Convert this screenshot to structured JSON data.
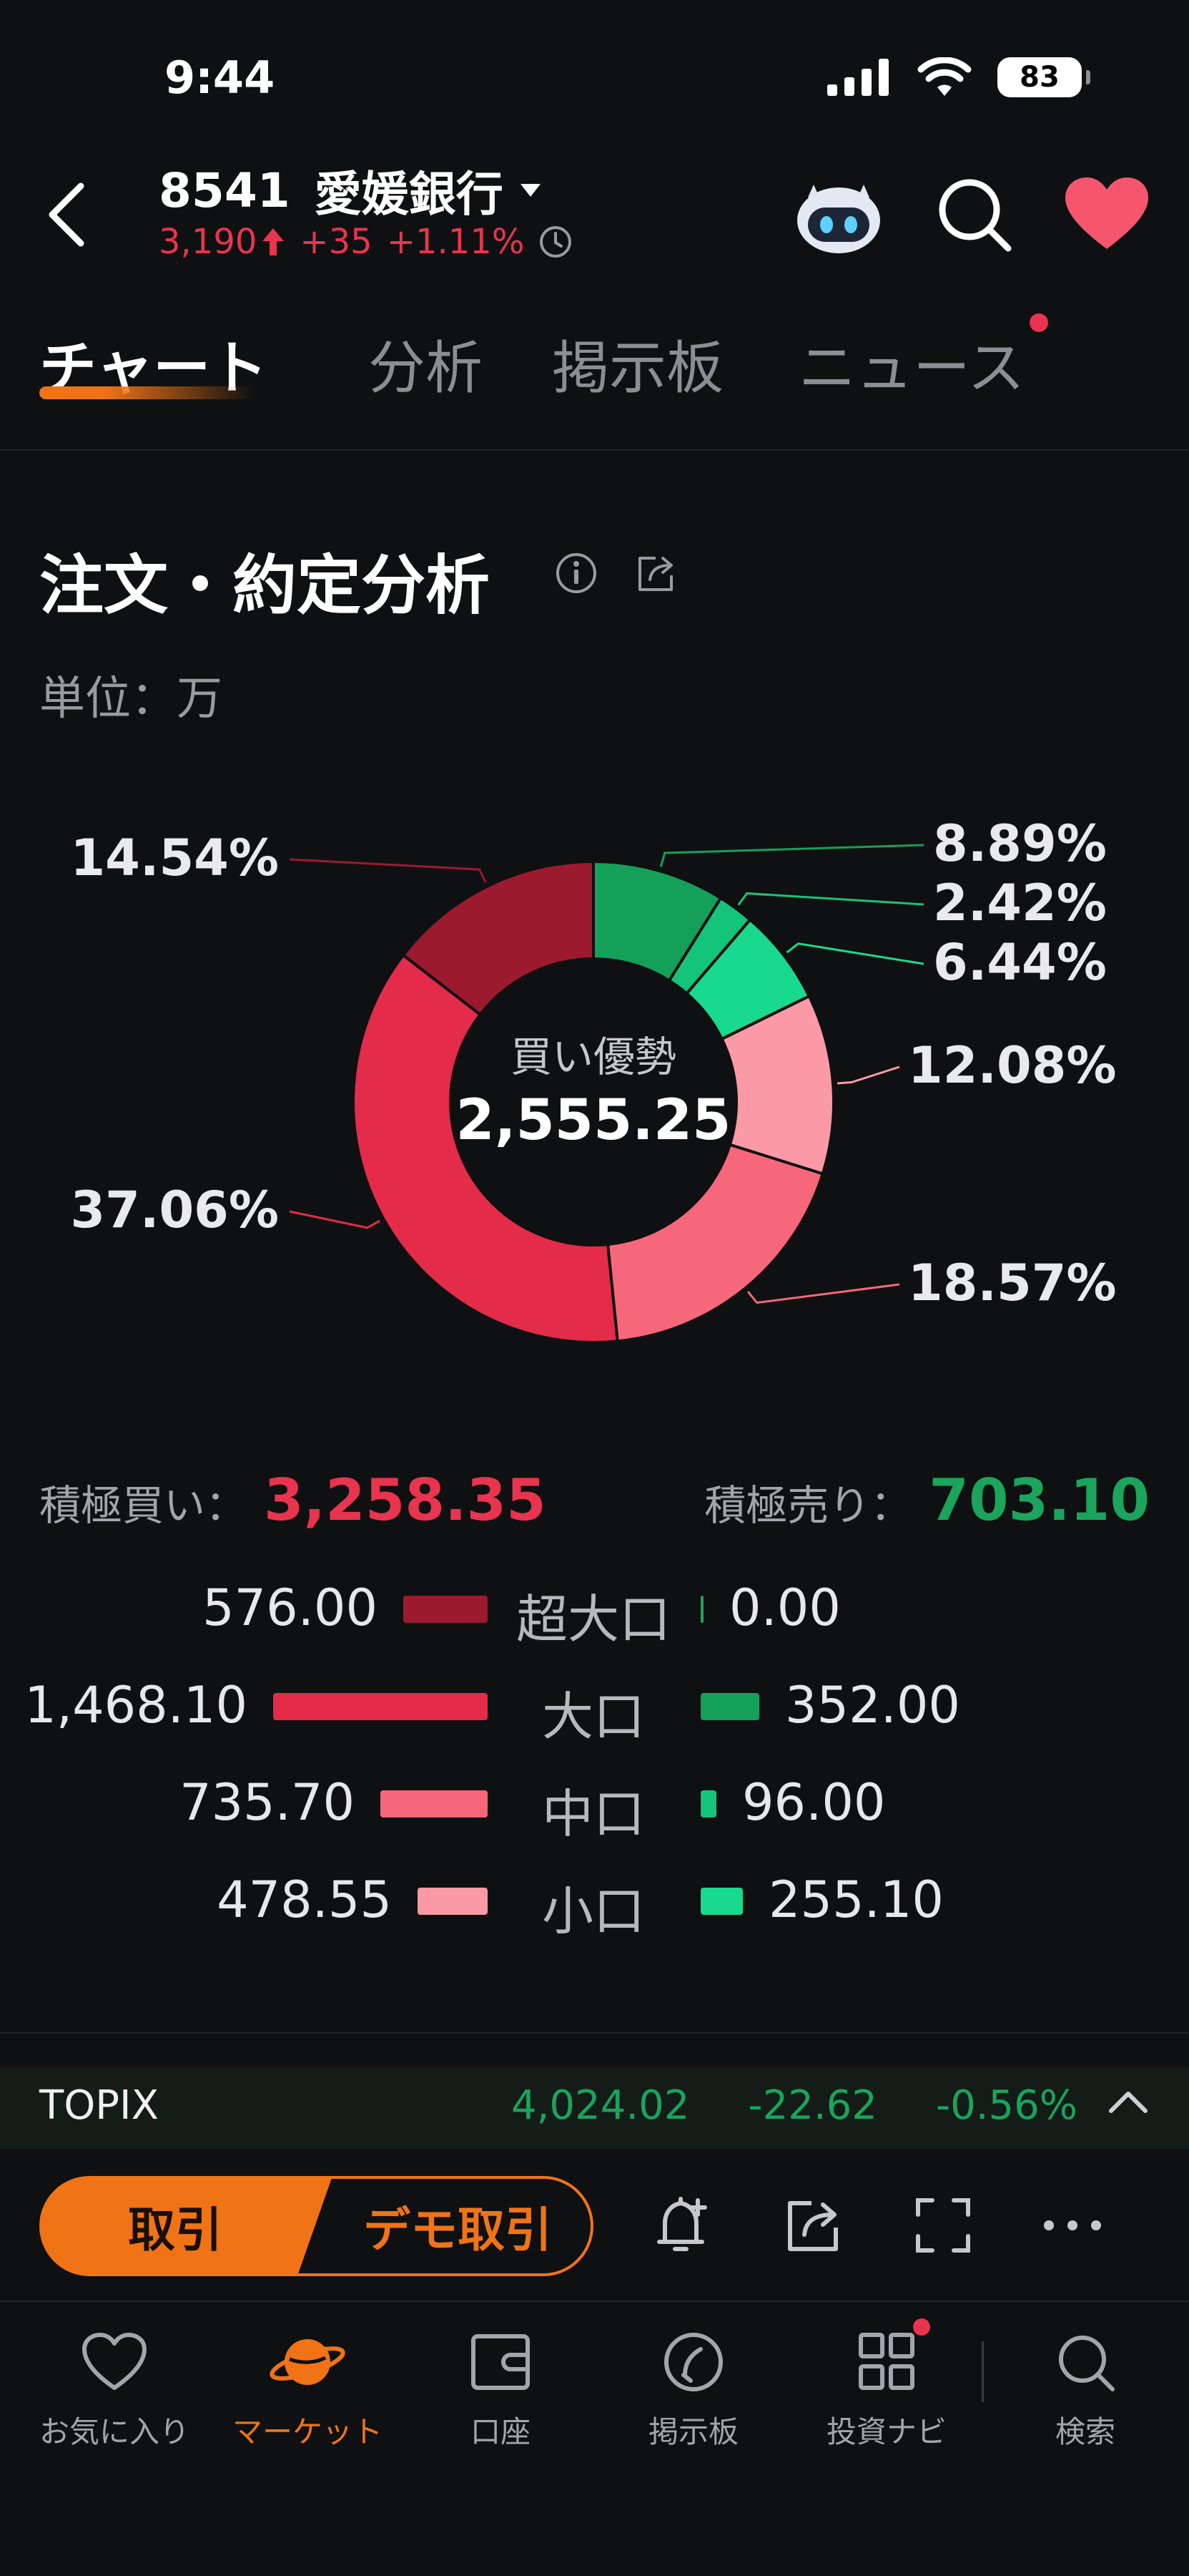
{
  "status": {
    "time": "9:44",
    "battery": "83"
  },
  "header": {
    "code": "8541",
    "name": "愛媛銀行",
    "price": "3,190",
    "change": "+35",
    "change_pct": "+1.11%"
  },
  "tabs": [
    {
      "label": "チャート"
    },
    {
      "label": "分析"
    },
    {
      "label": "掲示板"
    },
    {
      "label": "ニュース"
    }
  ],
  "section": {
    "title": "注文・約定分析",
    "unit": "単位：万"
  },
  "chart_data": {
    "type": "pie",
    "center_label": "買い優勢",
    "center_value": "2,555.25",
    "slices": [
      {
        "name": "超大口 売り",
        "value": 0.0,
        "pct_label": "",
        "color": "#1fa35a"
      },
      {
        "name": "大口 売り",
        "value": 8.89,
        "pct_label": "8.89%",
        "color": "#15a05a"
      },
      {
        "name": "中口 売り",
        "value": 2.42,
        "pct_label": "2.42%",
        "color": "#14c47a"
      },
      {
        "name": "小口 売り",
        "value": 6.44,
        "pct_label": "6.44%",
        "color": "#19d98e"
      },
      {
        "name": "小口 買い",
        "value": 12.08,
        "pct_label": "12.08%",
        "color": "#fb9aa6"
      },
      {
        "name": "中口 買い",
        "value": 18.57,
        "pct_label": "18.57%",
        "color": "#f7677b"
      },
      {
        "name": "大口 買い",
        "value": 37.06,
        "pct_label": "37.06%",
        "color": "#e42b4a"
      },
      {
        "name": "超大口 買い",
        "value": 14.54,
        "pct_label": "14.54%",
        "color": "#9c1a2e"
      }
    ]
  },
  "summary": {
    "buy_label": "積極買い：",
    "buy_value": "3,258.35",
    "sell_label": "積極売り：",
    "sell_value": "703.10"
  },
  "rows": [
    {
      "category": "超大口",
      "buy": "576.00",
      "buy_amount": 576.0,
      "sell": "0.00",
      "sell_amount": 0.0,
      "buy_color": "#9c1a2e"
    },
    {
      "category": "大口",
      "buy": "1,468.10",
      "buy_amount": 1468.1,
      "sell": "352.00",
      "sell_amount": 352.0,
      "buy_color": "#e42b4a"
    },
    {
      "category": "中口",
      "buy": "735.70",
      "buy_amount": 735.7,
      "sell": "96.00",
      "sell_amount": 96.0,
      "buy_color": "#f7677b"
    },
    {
      "category": "小口",
      "buy": "478.55",
      "buy_amount": 478.55,
      "sell": "255.10",
      "sell_amount": 255.1,
      "buy_color": "#fb9aa6"
    }
  ],
  "topix": {
    "name": "TOPIX",
    "value": "4,024.02",
    "change": "-22.62",
    "change_pct": "-0.56%"
  },
  "actions": {
    "trade": "取引",
    "demo": "デモ取引"
  },
  "nav": [
    {
      "label": "お気に入り",
      "icon": "heart-icon"
    },
    {
      "label": "マーケット",
      "icon": "planet-icon"
    },
    {
      "label": "口座",
      "icon": "wallet-icon"
    },
    {
      "label": "掲示板",
      "icon": "board-icon"
    },
    {
      "label": "投資ナビ",
      "icon": "grid-icon"
    },
    {
      "label": "検索",
      "icon": "search-icon"
    }
  ],
  "colors": {
    "accent": "#f07316",
    "up": "#e8344e",
    "down": "#1aa45c"
  }
}
